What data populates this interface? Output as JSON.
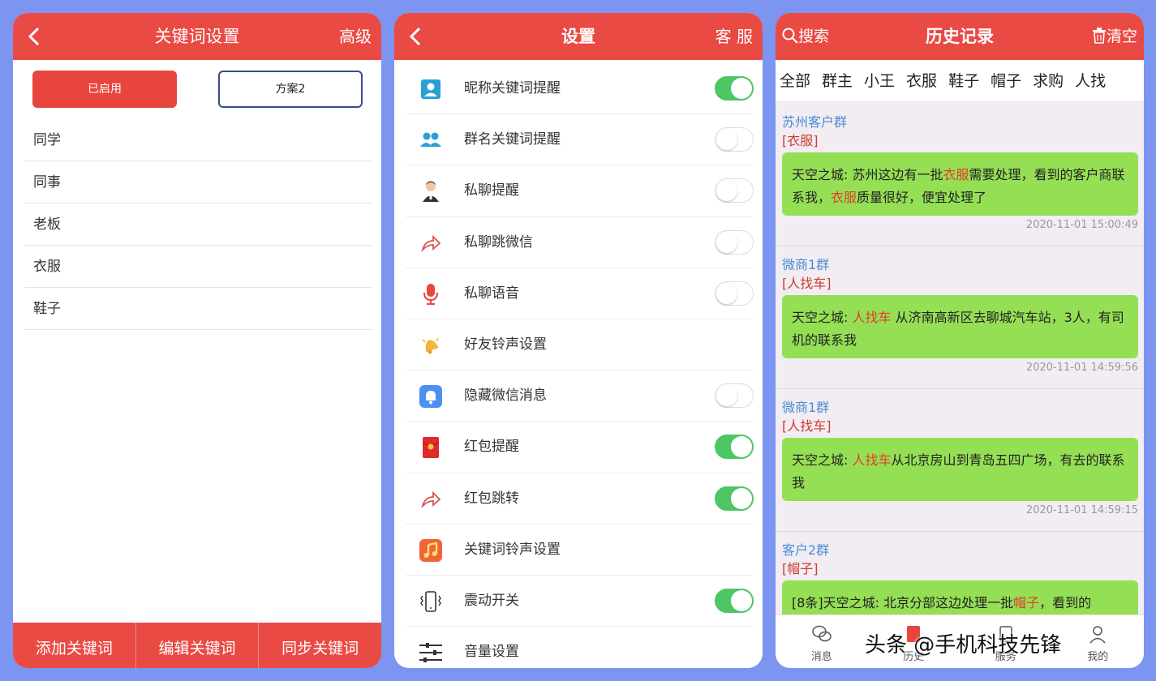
{
  "screen1": {
    "title": "关键词设置",
    "right_action": "高级",
    "enabled_label": "已启用",
    "plan_label": "方案2",
    "keywords": [
      "同学",
      "同事",
      "老板",
      "衣服",
      "鞋子"
    ],
    "actions": [
      "添加关键词",
      "编辑关键词",
      "同步关键词"
    ]
  },
  "screen2": {
    "title": "设置",
    "right_action": "客 服",
    "items": [
      {
        "label": "昵称关键词提醒",
        "icon": "user-card-icon",
        "toggle": "on"
      },
      {
        "label": "群名关键词提醒",
        "icon": "group-icon",
        "toggle": "off"
      },
      {
        "label": "私聊提醒",
        "icon": "person-icon",
        "toggle": "off"
      },
      {
        "label": "私聊跳微信",
        "icon": "share-arrow-icon",
        "toggle": "off"
      },
      {
        "label": "私聊语音",
        "icon": "microphone-icon",
        "toggle": "off"
      },
      {
        "label": "好友铃声设置",
        "icon": "bell-icon",
        "toggle": "none"
      },
      {
        "label": "隐藏微信消息",
        "icon": "notification-icon",
        "toggle": "off"
      },
      {
        "label": "红包提醒",
        "icon": "red-envelope-icon",
        "toggle": "on"
      },
      {
        "label": "红包跳转",
        "icon": "share-arrow-icon",
        "toggle": "on"
      },
      {
        "label": "关键词铃声设置",
        "icon": "music-note-icon",
        "toggle": "none"
      },
      {
        "label": "震动开关",
        "icon": "vibrate-phone-icon",
        "toggle": "on"
      },
      {
        "label": "音量设置",
        "icon": "sliders-icon",
        "toggle": "none"
      }
    ]
  },
  "screen3": {
    "search_label": "搜索",
    "title": "历史记录",
    "clear_label": "清空",
    "filters": [
      "全部",
      "群主",
      "小王",
      "衣服",
      "鞋子",
      "帽子",
      "求购",
      "人找"
    ],
    "records": [
      {
        "group": "苏州客户群",
        "tag": "[衣服]",
        "parts": [
          "天空之城: 苏州这边有一批",
          "衣服",
          "需要处理，看到的客户商联系我，",
          "衣服",
          "质量很好，便宜处理了"
        ],
        "time": "2020-11-01 15:00:49"
      },
      {
        "group": "微商1群",
        "tag": "[人找车]",
        "parts": [
          "天空之城: ",
          "人找车",
          " 从济南高新区去聊城汽车站，3人，有司机的联系我",
          "",
          ""
        ],
        "time": "2020-11-01 14:59:56"
      },
      {
        "group": "微商1群",
        "tag": "[人找车]",
        "parts": [
          "天空之城: ",
          "人找车",
          "从北京房山到青岛五四广场，有去的联系我",
          "",
          ""
        ],
        "time": "2020-11-01 14:59:15"
      },
      {
        "group": "客户2群",
        "tag": "[帽子]",
        "parts": [
          "[8条]天空之城: 北京分部这边处理一批",
          "帽子",
          "，看到的",
          "",
          ""
        ],
        "time": ""
      }
    ],
    "tabs": [
      "消息",
      "历史",
      "服务",
      "我的"
    ],
    "watermark": "头条 @手机科技先锋"
  }
}
